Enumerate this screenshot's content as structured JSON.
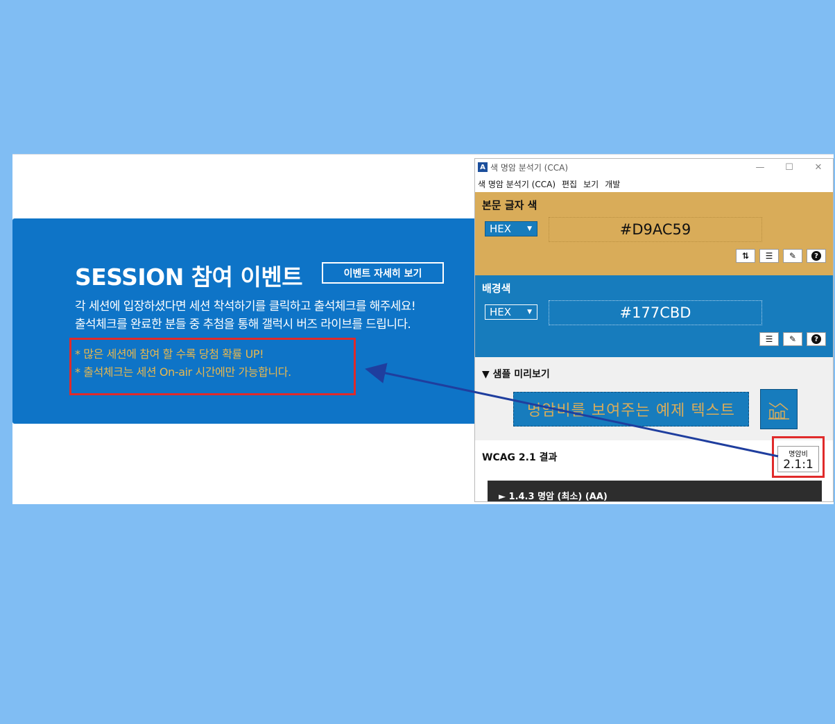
{
  "webpage": {
    "banner_title": "SESSION 참여 이벤트",
    "detail_button": "이벤트 자세히 보기",
    "desc_line1": "각 세션에 입장하셨다면 세션 착석하기를 클릭하고 출석체크를 해주세요!",
    "desc_line2": "출석체크를 완료한 분들 중 추첨을 통해 갤럭시 버즈 라이브를 드립니다.",
    "note_line1": "* 많은 세션에 참여 할 수록 당첨 확률 UP!",
    "note_line2": "* 출석체크는 세션 On-air 시간에만 가능합니다.",
    "banner_color": "#0E74C7",
    "note_color": "#E8B84E"
  },
  "cca": {
    "title": "색 명암 분석기 (CCA)",
    "menu": [
      "색 명암 분석기 (CCA)",
      "편집",
      "보기",
      "개발"
    ],
    "foreground": {
      "label": "본문 글자 색",
      "format": "HEX",
      "value": "#D9AC59"
    },
    "background": {
      "label": "배경색",
      "format": "HEX",
      "value": "#177CBD"
    },
    "sample": {
      "label": "▼ 샘플 미리보기",
      "text": "명암비를 보여주는 예제 텍스트"
    },
    "result": {
      "label": "WCAG 2.1 결과",
      "ratio_caption": "명암비",
      "ratio_value": "2.1:1",
      "criterion": "► 1.4.3 명암 (최소) (AA)"
    }
  },
  "colors": {
    "page_background": "#80BDF3",
    "highlight_red": "#E02A2A",
    "arrow_blue": "#1F3E9E"
  }
}
